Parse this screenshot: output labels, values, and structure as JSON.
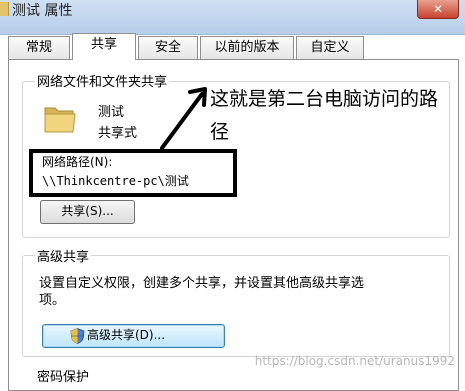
{
  "window": {
    "title": "测试 属性",
    "close_label": "✕"
  },
  "tabs": [
    {
      "label": "常规"
    },
    {
      "label": "共享",
      "active": true
    },
    {
      "label": "安全"
    },
    {
      "label": "以前的版本"
    },
    {
      "label": "自定义"
    }
  ],
  "network_share": {
    "group_title": "网络文件和文件夹共享",
    "item_name": "测试",
    "item_status": "共享式",
    "path_label": "网络路径(N):",
    "path_value": "\\\\Thinkcentre-pc\\测试",
    "share_button": "共享(S)..."
  },
  "advanced_share": {
    "group_title": "高级共享",
    "description_line1": "设置自定义权限，创建多个共享，并设置其他高级共享选",
    "description_line2": "项。",
    "button_label": "高级共享(D)..."
  },
  "partial_group_title": "密码保护",
  "annotation": {
    "line1": "这就是第二台电脑访问的路",
    "line2": "径"
  },
  "watermark": "https://blog.csdn.net/uranus1992",
  "colors": {
    "highlight_box": "#000000",
    "arrow": "#000000",
    "folder": "#e8c96a"
  },
  "icons": {
    "folder": "folder-icon",
    "shield": "shield-icon",
    "arrow": "annotation-arrow"
  }
}
